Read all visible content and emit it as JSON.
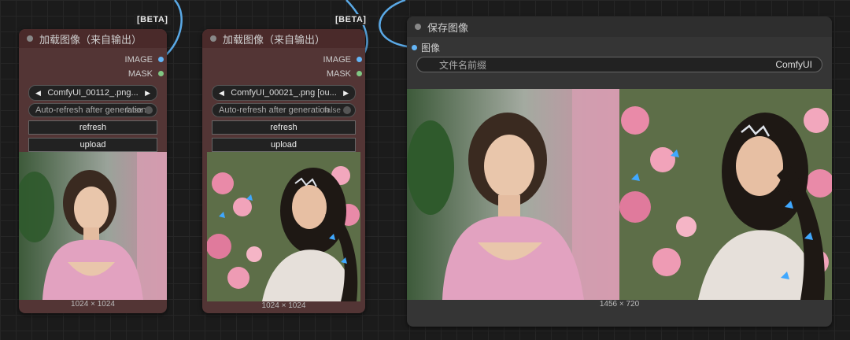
{
  "colors": {
    "image_slot": "#64b5f6",
    "mask_slot": "#81c784",
    "wire": "#5aa9e6",
    "load_node_bg": "#533535",
    "save_node_bg": "#353535"
  },
  "beta_badge": "[BETA]",
  "load_nodes": [
    {
      "title": "加载图像（来自输出）",
      "outputs": [
        "IMAGE",
        "MASK"
      ],
      "image_value": "ComfyUI_00112_.png...",
      "auto_refresh_label": "Auto-refresh after generation",
      "auto_refresh_value": "false",
      "refresh_label": "refresh",
      "upload_label": "upload",
      "size": "1024 × 1024"
    },
    {
      "title": "加载图像（来自输出）",
      "outputs": [
        "IMAGE",
        "MASK"
      ],
      "image_value": "ComfyUI_00021_.png [ou...",
      "auto_refresh_label": "Auto-refresh after generation",
      "auto_refresh_value": "false",
      "refresh_label": "refresh",
      "upload_label": "upload",
      "size": "1024 × 1024"
    }
  ],
  "save_node": {
    "title": "保存图像",
    "input": "图像",
    "prefix_label": "文件名前缀",
    "prefix_value": "ComfyUI",
    "size": "1456 × 720"
  }
}
